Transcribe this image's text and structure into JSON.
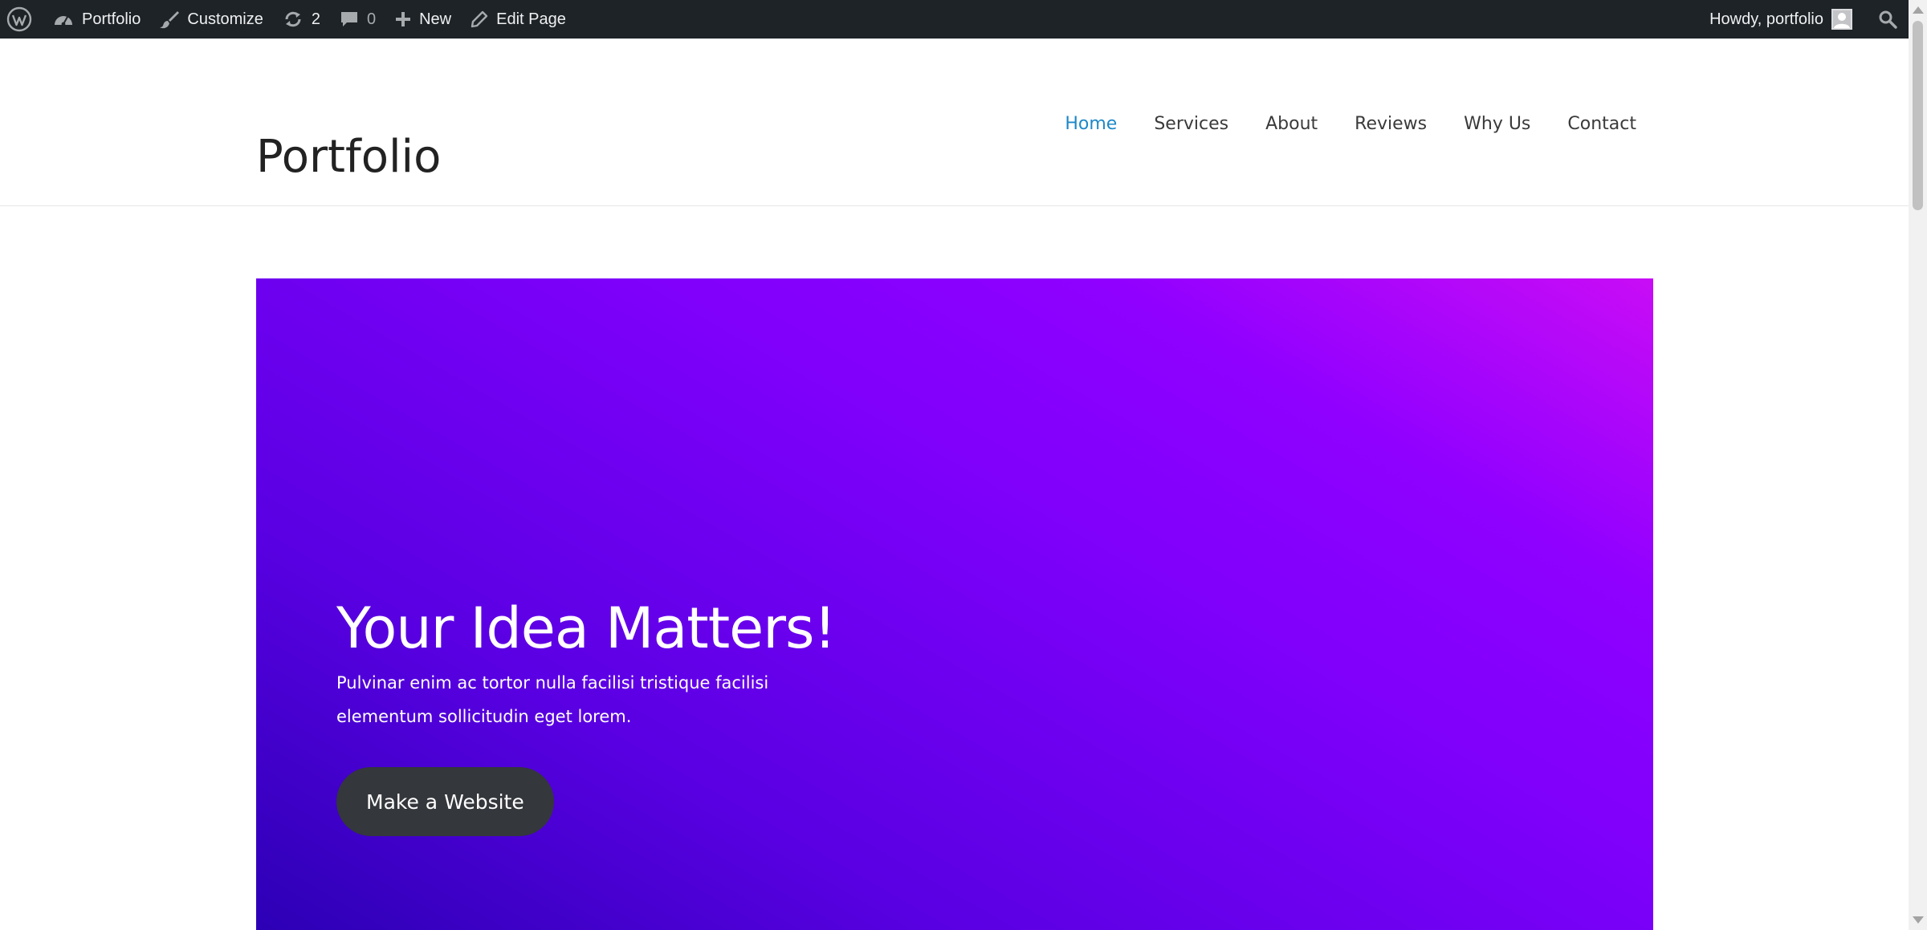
{
  "admin_bar": {
    "site_name": "Portfolio",
    "customize": "Customize",
    "updates_count": "2",
    "comments_count": "0",
    "new": "New",
    "edit_page": "Edit Page",
    "greeting": "Howdy, portfolio"
  },
  "header": {
    "site_title": "Portfolio",
    "nav": [
      {
        "label": "Home",
        "active": true
      },
      {
        "label": "Services"
      },
      {
        "label": "About"
      },
      {
        "label": "Reviews"
      },
      {
        "label": "Why Us"
      },
      {
        "label": "Contact"
      }
    ]
  },
  "hero": {
    "title": "Your Idea Matters!",
    "text": "Pulvinar enim ac tortor nulla facilisi tristique facilisi elementum sollicitudin eget lorem.",
    "button_label": "Make a Website"
  },
  "colors": {
    "admin_bar_bg": "#1d2327",
    "nav_active": "#1e88c7",
    "button_bg": "#34373b",
    "gradient_start": "#2c00b5",
    "gradient_end": "#c90cf6"
  },
  "icons": {
    "wordpress": "wordpress-logo-icon",
    "dashboard": "dashboard-icon",
    "customize": "paintbrush-icon",
    "updates": "updates-icon",
    "comments": "comment-bubble-icon",
    "new": "plus-icon",
    "edit": "pencil-icon",
    "search": "search-icon",
    "avatar": "user-avatar-icon"
  }
}
